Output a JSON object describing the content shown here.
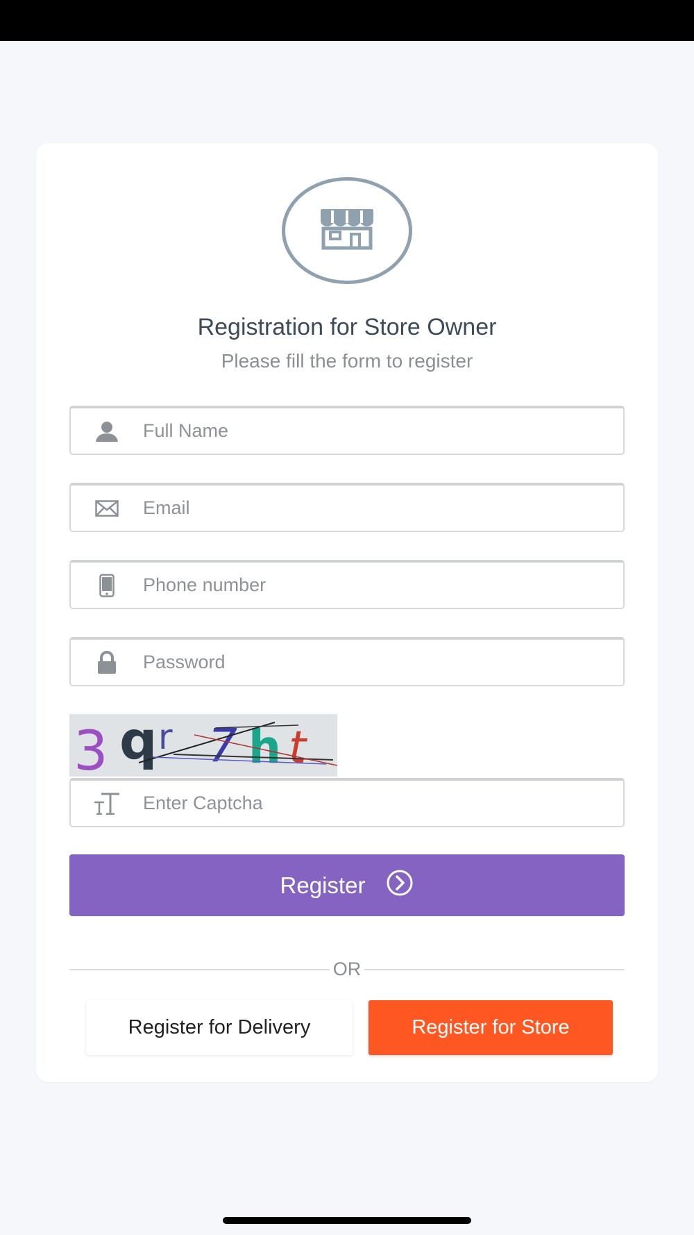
{
  "header": {
    "title": "Registration for Store Owner",
    "subtitle": "Please fill the form to register",
    "icon": "store-icon"
  },
  "form": {
    "full_name": {
      "placeholder": "Full Name",
      "value": "",
      "icon": "user-icon"
    },
    "email": {
      "placeholder": "Email",
      "value": "",
      "icon": "envelope-icon"
    },
    "phone": {
      "placeholder": "Phone number",
      "value": "",
      "icon": "phone-icon"
    },
    "password": {
      "placeholder": "Password",
      "value": "",
      "icon": "lock-icon"
    },
    "captcha_image_text": "3qr7ht",
    "captcha": {
      "placeholder": "Enter Captcha",
      "value": "",
      "icon": "text-icon"
    }
  },
  "actions": {
    "register_label": "Register",
    "or_label": "OR",
    "delivery_label": "Register for Delivery",
    "store_label": "Register for Store"
  },
  "colors": {
    "primary": "#8463c2",
    "accent": "#ff5722",
    "icon": "#8fa1ae"
  }
}
